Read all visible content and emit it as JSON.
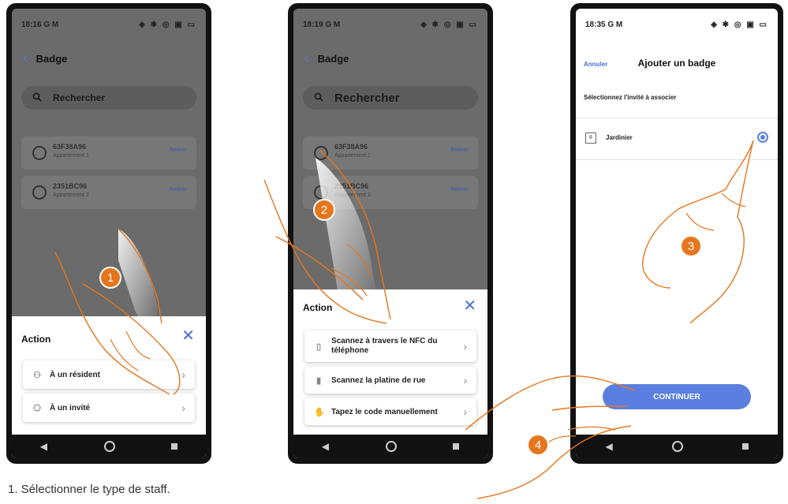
{
  "phone1": {
    "time": "18:16",
    "status_icons": "G M",
    "right_icons": "◈ ✱ ◎ ▣ ▭",
    "header_title": "Badge",
    "search_label": "Rechercher",
    "badges": [
      {
        "code": "63F38A96",
        "sub": "Appartement 1",
        "action": "Retirer"
      },
      {
        "code": "2351BC96",
        "sub": "Appartement 2",
        "action": "Retirer"
      }
    ],
    "sheet_title": "Action",
    "options": [
      {
        "label": "À un résident"
      },
      {
        "label": "À un invité"
      }
    ],
    "step": "1"
  },
  "phone2": {
    "time": "18:19",
    "status_icons": "G M",
    "right_icons": "◈ ✱ ◎ ▣ ▭",
    "header_title": "Badge",
    "search_label": "Rechercher",
    "badges": [
      {
        "code": "63F38A96",
        "sub": "Appartement 1",
        "action": "Retirer"
      },
      {
        "code": "2351BC96",
        "sub": "Appartement 2",
        "action": "Retirer"
      }
    ],
    "sheet_title": "Action",
    "options": [
      {
        "label": "Scannez à travers le NFC du téléphone"
      },
      {
        "label": "Scannez la platine de rue"
      },
      {
        "label": "Tapez le code manuellement"
      }
    ],
    "step": "2"
  },
  "phone3": {
    "time": "18:35",
    "status_icons": "G M",
    "right_icons": "◈ ✱ ◎ ▣ ▭",
    "cancel_label": "Annuler",
    "title": "Ajouter un badge",
    "section_label": "Sélectionnez l'invité à associer",
    "guest_label": "Jardinier",
    "continue_label": "CONTINUER",
    "step3": "3",
    "step4": "4"
  },
  "caption": "1.   Sélectionner le type de staff.",
  "colors": {
    "accent": "#e4761d",
    "primary": "#5b7fe0"
  }
}
